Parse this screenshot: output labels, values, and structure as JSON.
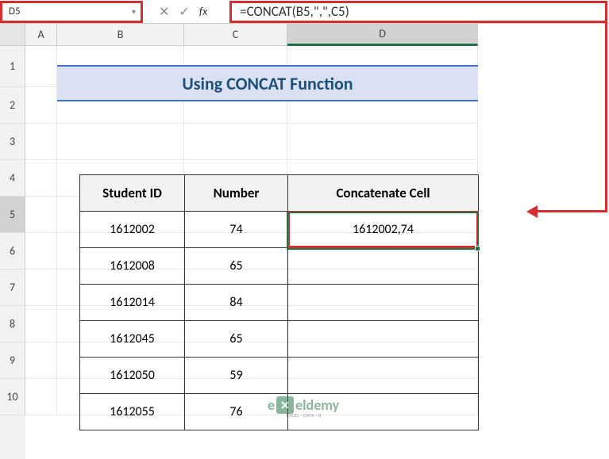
{
  "nameBox": "D5",
  "formulaBar": "=CONCAT(B5,\",\",C5)",
  "columns": [
    "A",
    "B",
    "C",
    "D"
  ],
  "rows": [
    "1",
    "2",
    "3",
    "4",
    "5",
    "6",
    "7",
    "8",
    "9",
    "10"
  ],
  "title": "Using CONCAT Function",
  "table": {
    "headers": {
      "b": "Student ID",
      "c": "Number",
      "d": "Concatenate Cell"
    },
    "data": [
      {
        "b": "1612002",
        "c": "74",
        "d": "1612002,74"
      },
      {
        "b": "1612008",
        "c": "65",
        "d": ""
      },
      {
        "b": "1612014",
        "c": "84",
        "d": ""
      },
      {
        "b": "1612045",
        "c": "65",
        "d": ""
      },
      {
        "b": "1612050",
        "c": "59",
        "d": ""
      },
      {
        "b": "1612055",
        "c": "76",
        "d": ""
      }
    ]
  },
  "watermark": {
    "prefix": "e",
    "suffix": "eldemy",
    "sub": "EXCEL · DATA · B"
  },
  "selectedRow": "5"
}
